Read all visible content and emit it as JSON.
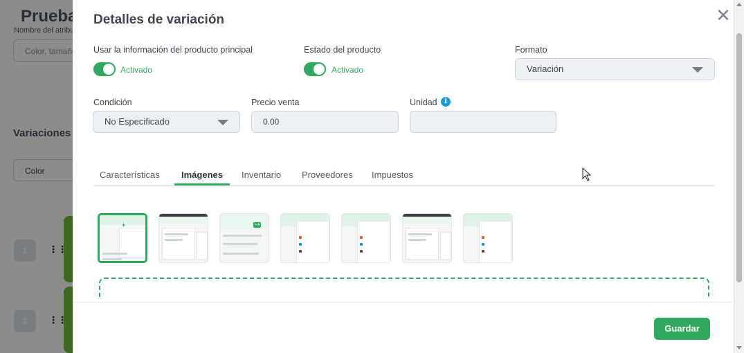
{
  "background": {
    "page_title": "Prueba",
    "attribute_label": "Nombre del atributo",
    "attribute_placeholder": "Color, tamaño",
    "section_title": "Variaciones",
    "attribute_select_value": "Color",
    "rows": [
      {
        "number": "1"
      },
      {
        "number": "2"
      }
    ]
  },
  "modal": {
    "title": "Detalles de variación",
    "close_icon": "close-icon",
    "use_main_info": {
      "label": "Usar la información del producto principal",
      "state_text": "Activado",
      "on": true
    },
    "product_status": {
      "label": "Estado del producto",
      "state_text": "Activado",
      "on": true
    },
    "format": {
      "label": "Formato",
      "value": "Variación"
    },
    "condition": {
      "label": "Condición",
      "value": "No Especificado"
    },
    "sale_price": {
      "label": "Precio venta",
      "value": "0.00"
    },
    "unit": {
      "label": "Unidad",
      "value": "",
      "info_icon": "info-icon"
    },
    "tabs": [
      {
        "label": "Características",
        "active": false
      },
      {
        "label": "Imágenes",
        "active": true
      },
      {
        "label": "Inventario",
        "active": false
      },
      {
        "label": "Proveedores",
        "active": false
      },
      {
        "label": "Impuestos",
        "active": false
      }
    ],
    "images": {
      "selected_index": 0,
      "count": 7
    },
    "save_label": "Guardar"
  },
  "colors": {
    "accent": "#30a85f",
    "info": "#1e9bd7",
    "overlay": "rgba(0,0,0,0.45)"
  }
}
